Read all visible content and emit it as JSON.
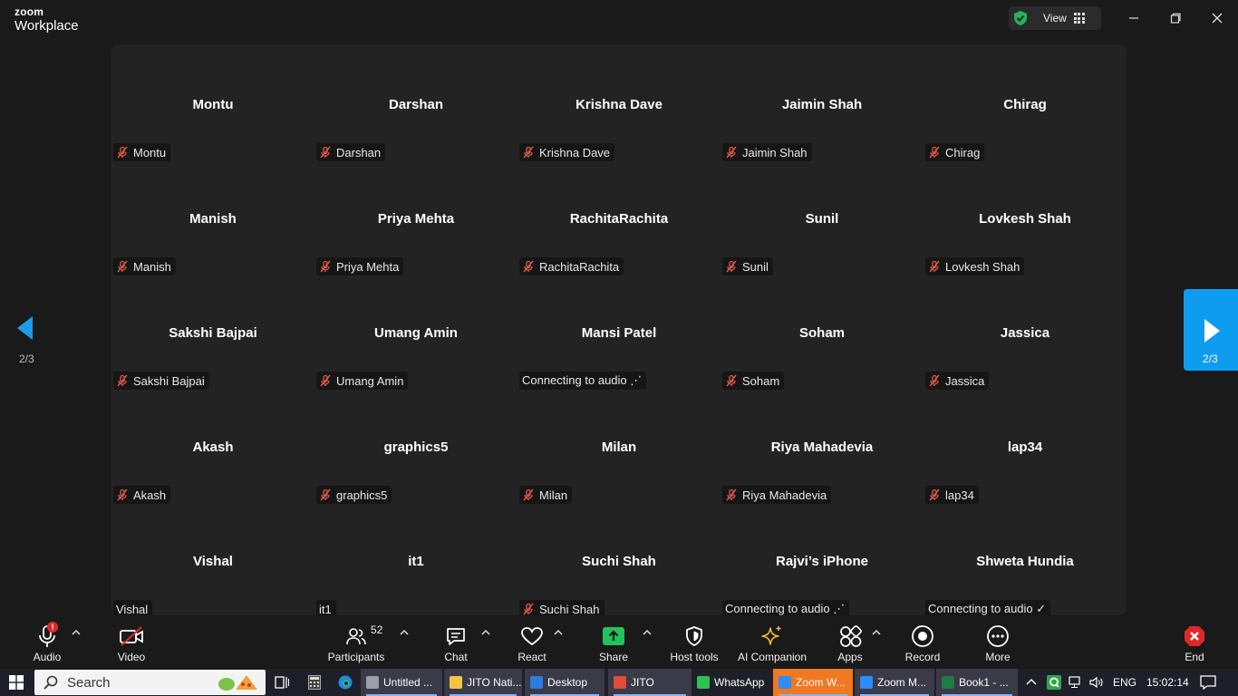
{
  "app": {
    "brand_line1": "zoom",
    "brand_line2": "Workplace",
    "view_label": "View"
  },
  "gallery": {
    "page_indicator": "2/3",
    "participants": [
      {
        "name": "Montu",
        "plate": "Montu",
        "muted": true
      },
      {
        "name": "Darshan",
        "plate": "Darshan",
        "muted": true
      },
      {
        "name": "Krishna Dave",
        "plate": "Krishna Dave",
        "muted": true
      },
      {
        "name": "Jaimin Shah",
        "plate": "Jaimin Shah",
        "muted": true
      },
      {
        "name": "Chirag",
        "plate": "Chirag",
        "muted": true
      },
      {
        "name": "Manish",
        "plate": "Manish",
        "muted": true
      },
      {
        "name": "Priya Mehta",
        "plate": "Priya Mehta",
        "muted": true
      },
      {
        "name": "RachitaRachita",
        "plate": "RachitaRachita",
        "muted": true
      },
      {
        "name": "Sunil",
        "plate": "Sunil",
        "muted": true
      },
      {
        "name": "Lovkesh Shah",
        "plate": "Lovkesh Shah",
        "muted": true
      },
      {
        "name": "Sakshi Bajpai",
        "plate": "Sakshi Bajpai",
        "muted": true
      },
      {
        "name": "Umang Amin",
        "plate": "Umang Amin",
        "muted": true
      },
      {
        "name": "Mansi Patel",
        "plate": "Connecting to audio ⋰",
        "muted": false
      },
      {
        "name": "Soham",
        "plate": "Soham",
        "muted": true
      },
      {
        "name": "Jassica",
        "plate": "Jassica",
        "muted": true
      },
      {
        "name": "Akash",
        "plate": "Akash",
        "muted": true
      },
      {
        "name": "graphics5",
        "plate": "graphics5",
        "muted": true
      },
      {
        "name": "Milan",
        "plate": "Milan",
        "muted": true
      },
      {
        "name": "Riya Mahadevia",
        "plate": "Riya Mahadevia",
        "muted": true
      },
      {
        "name": "lap34",
        "plate": "lap34",
        "muted": true
      },
      {
        "name": "Vishal",
        "plate": "Vishal",
        "muted": false
      },
      {
        "name": "it1",
        "plate": "it1",
        "muted": false
      },
      {
        "name": "Suchi Shah",
        "plate": "Suchi Shah",
        "muted": true
      },
      {
        "name": "Rajvi’s iPhone",
        "plate": "Connecting to audio ⋰",
        "muted": false
      },
      {
        "name": "Shweta Hundia",
        "plate": "Connecting to audio ✓",
        "muted": false
      }
    ]
  },
  "toolbar": {
    "audio": "Audio",
    "audio_badge": "!",
    "video": "Video",
    "participants": "Participants",
    "participants_count": "52",
    "chat": "Chat",
    "react": "React",
    "share": "Share",
    "host_tools": "Host tools",
    "ai_companion": "AI Companion",
    "apps": "Apps",
    "record": "Record",
    "more": "More",
    "end": "End"
  },
  "taskbar": {
    "search_placeholder": "Search",
    "apps": [
      {
        "label": "Untitled ..."
      },
      {
        "label": "JITO Nati..."
      },
      {
        "label": "Desktop"
      },
      {
        "label": "JITO"
      },
      {
        "label": "WhatsApp"
      },
      {
        "label": "Zoom W..."
      },
      {
        "label": "Zoom M..."
      },
      {
        "label": "Book1 - ..."
      }
    ],
    "lang": "ENG",
    "time": "15:02:14"
  },
  "colors": {
    "accent_blue": "#0e9cf0",
    "share_green": "#22c35e",
    "end_red": "#e02828",
    "mute_red": "#e05a4a"
  }
}
